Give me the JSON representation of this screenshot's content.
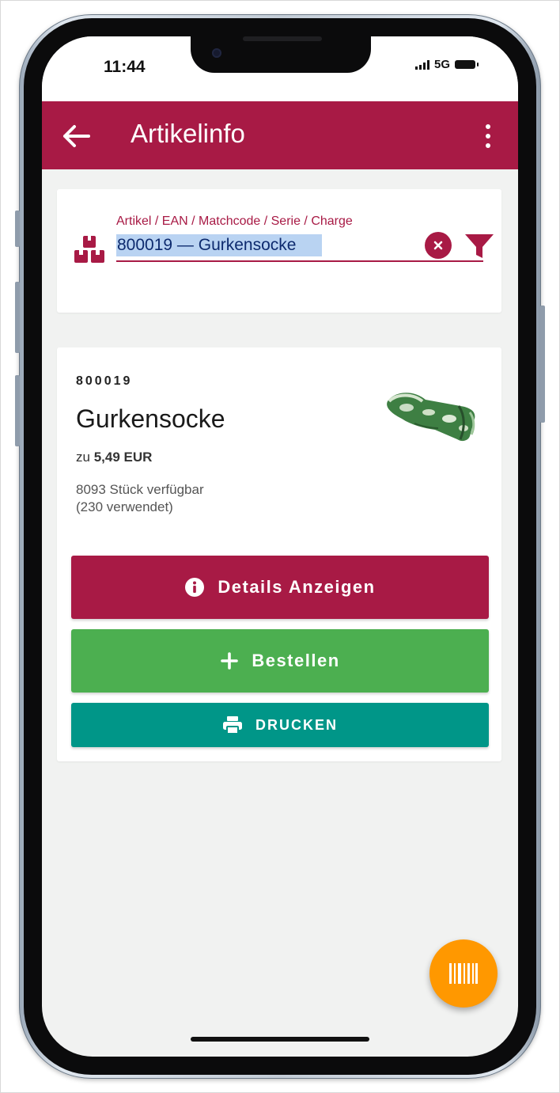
{
  "status_bar": {
    "time": "11:44",
    "network": "5G"
  },
  "app_bar": {
    "back_icon": "arrow-left-icon",
    "title": "Artikelinfo",
    "menu_icon": "more-vert-icon",
    "color": "#a81a45"
  },
  "search": {
    "label": "Artikel / EAN / Matchcode / Serie / Charge",
    "value": "800019 — Gurkensocke",
    "field_icon": "boxes-icon",
    "clear_icon": "clear-circle-icon",
    "filter_icon": "filter-icon"
  },
  "article": {
    "number": "800019",
    "name": "Gurkensocke",
    "price_prefix": "zu",
    "price": "5,49 EUR",
    "stock": "8093 Stück verfügbar",
    "used": "(230 verwendet)",
    "image": "sock-image"
  },
  "buttons": {
    "details": {
      "label": "Details Anzeigen",
      "icon": "info-icon",
      "color": "#a81a45"
    },
    "order": {
      "label": "Bestellen",
      "icon": "plus-icon",
      "color": "#4caf50"
    },
    "print": {
      "label": "DRUCKEN",
      "icon": "printer-icon",
      "color": "#009688"
    }
  },
  "fab": {
    "icon": "barcode-icon",
    "color": "#ff9800"
  }
}
